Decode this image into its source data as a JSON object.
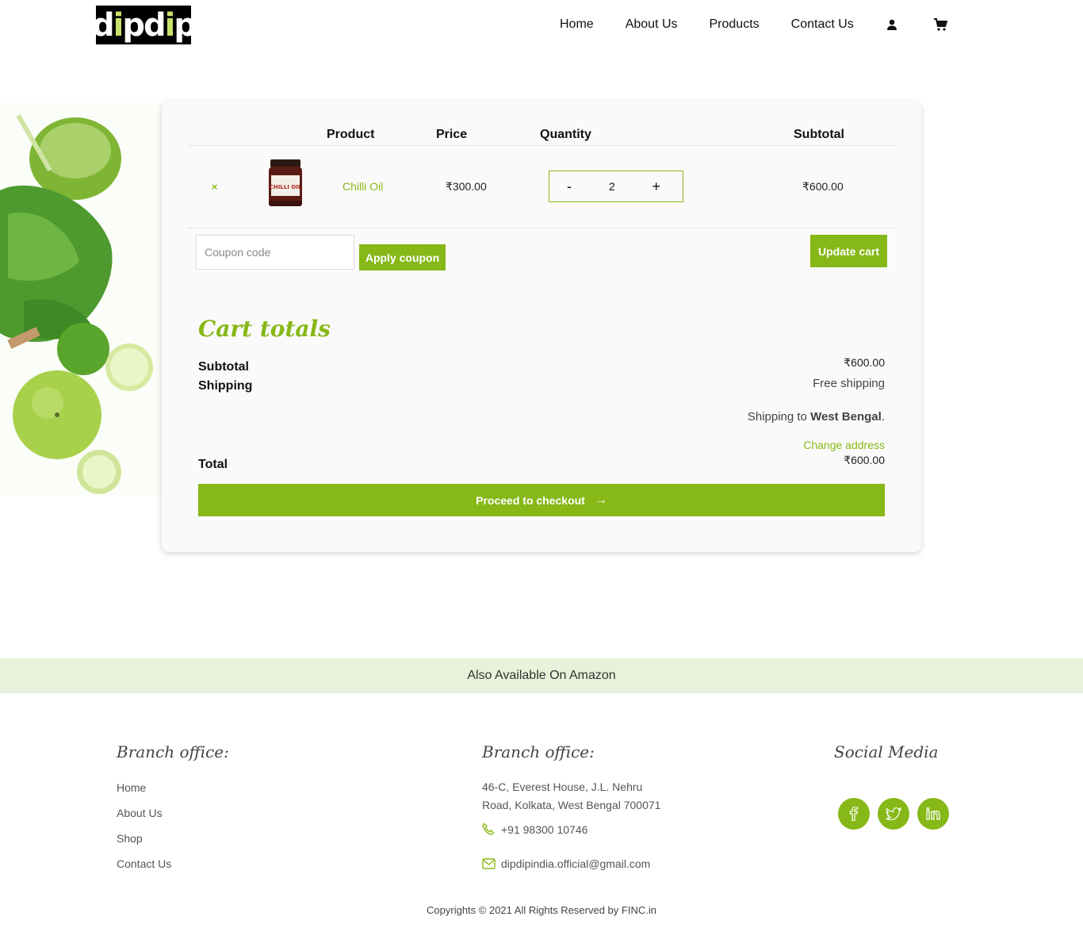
{
  "header": {
    "logo_text": "dipdip",
    "nav": [
      "Home",
      "About Us",
      "Products",
      "Contact Us"
    ],
    "icons": [
      "user-icon",
      "cart-icon"
    ]
  },
  "cart": {
    "columns": [
      "Product",
      "Price",
      "Quantity",
      "Subtotal"
    ],
    "item": {
      "remove": "×",
      "image_label": "CHILLI OIL",
      "name": "Chilli Oil",
      "price": "₹300.00",
      "quantity": "2",
      "minus": "-",
      "plus": "+",
      "subtotal": "₹600.00"
    },
    "coupon_placeholder": "Coupon code",
    "apply_label": "Apply coupon",
    "update_label": "Update cart"
  },
  "totals": {
    "title": "Cart totals",
    "subtotal_label": "Subtotal",
    "subtotal_value": "₹600.00",
    "shipping_label": "Shipping",
    "shipping_value": "Free shipping",
    "shipping_to_prefix": "Shipping to ",
    "shipping_to_region": "West Bengal",
    "shipping_to_suffix": ".",
    "change_address": "Change address",
    "total_label": "Total",
    "total_value": "₹600.00",
    "checkout_label": "Proceed to checkout",
    "checkout_arrow": "→"
  },
  "amazon": "Also Available On Amazon",
  "footer": {
    "col1_title": "Branch office:",
    "links": [
      "Home",
      "About Us",
      "Shop",
      "Contact Us"
    ],
    "col2_title": "Branch office:",
    "address_line1": "46-C, Everest House, J.L. Nehru",
    "address_line2": "Road, Kolkata, West Bengal 700071",
    "phone": "+91 98300 10746",
    "email": "dipdipindia.official@gmail.com",
    "col3_title": "Social Media",
    "social": [
      "facebook-icon",
      "twitter-icon",
      "linkedin-icon"
    ],
    "copyright": "Copyrights © 2021 All Rights Reserved by FINC.in"
  },
  "colors": {
    "accent": "#86b817",
    "band": "#e8f2da"
  }
}
